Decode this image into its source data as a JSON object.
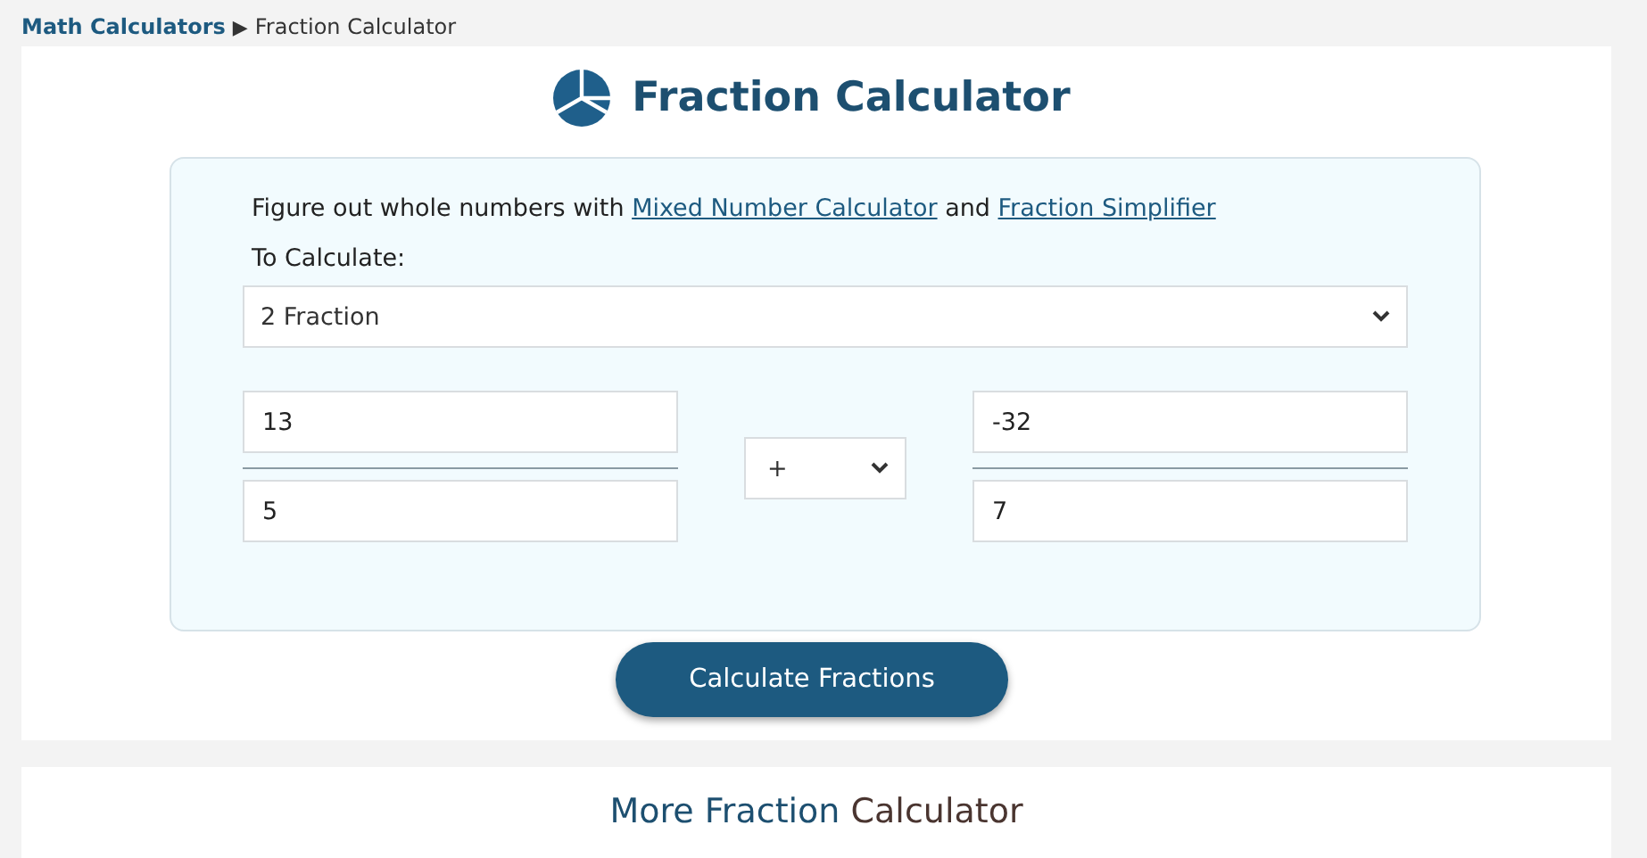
{
  "breadcrumb": {
    "link": "Math Calculators",
    "separator": "▶",
    "current": "Fraction Calculator"
  },
  "title": "Fraction Calculator",
  "intro": {
    "text": "Figure out whole numbers with",
    "link1": "Mixed Number Calculator",
    "joiner": "and",
    "link2": "Fraction Simplifier"
  },
  "calc_label": "To Calculate:",
  "mode_select": {
    "value": "2 Fraction"
  },
  "fraction_1": {
    "numerator": "13",
    "denominator": "5"
  },
  "operator_select": {
    "value": "+"
  },
  "fraction_2": {
    "numerator": "-32",
    "denominator": "7"
  },
  "calculate_button": "Calculate Fractions",
  "more_heading": {
    "lead": "More Fraction",
    "rest": "Calculator"
  }
}
